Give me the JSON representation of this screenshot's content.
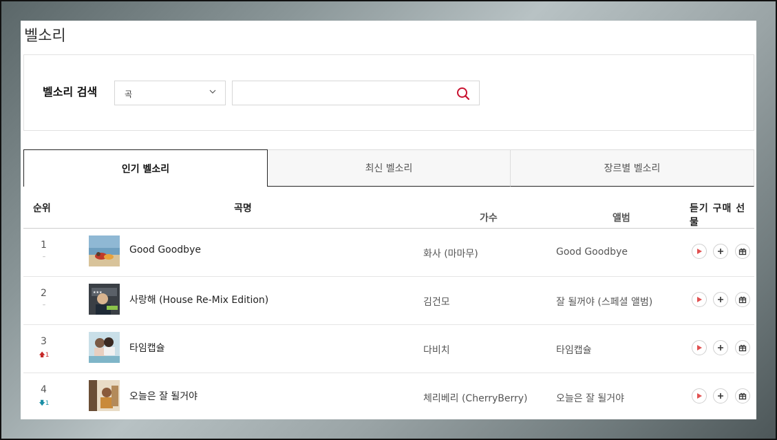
{
  "page_title": "벨소리",
  "search": {
    "label": "벨소리 검색",
    "select_value": "곡",
    "input_value": "",
    "placeholder": ""
  },
  "tabs": [
    {
      "label": "인기 벨소리",
      "active": true
    },
    {
      "label": "최신 벨소리",
      "active": false
    },
    {
      "label": "장르별 벨소리",
      "active": false
    }
  ],
  "table": {
    "headers": {
      "rank": "순위",
      "song": "곡명",
      "artist": "가수",
      "album": "앨범",
      "actions": "듣기 구매 선물"
    },
    "rows": [
      {
        "rank": "1",
        "change": "–",
        "change_dir": "none",
        "title": "Good Goodbye",
        "artist": "화사 (마마무)",
        "album": "Good Goodbye"
      },
      {
        "rank": "2",
        "change": "–",
        "change_dir": "none",
        "title": "사랑해 (House Re-Mix Edition)",
        "artist": "김건모",
        "album": "잘 될꺼야 (스페셜 앨범)"
      },
      {
        "rank": "3",
        "change": "1",
        "change_dir": "up",
        "title": "타임캡슐",
        "artist": "다비치",
        "album": "타임캡슐"
      },
      {
        "rank": "4",
        "change": "1",
        "change_dir": "down",
        "title": "오늘은 잘 될거야",
        "artist": "체리베리 (CherryBerry)",
        "album": "오늘은 잘 될거야"
      }
    ]
  },
  "colors": {
    "accent": "#c8102e",
    "up": "#c62828",
    "down": "#1a8fa6"
  },
  "icons": {
    "search": "search-icon",
    "dropdown": "chevron-down-icon",
    "play": "play-icon",
    "add": "plus-icon",
    "gift": "gift-icon"
  }
}
